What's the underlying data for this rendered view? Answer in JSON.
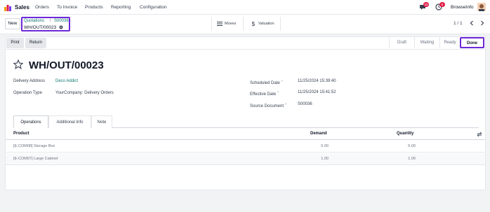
{
  "navbar": {
    "app_name": "Sales",
    "menus": [
      "Orders",
      "To Invoice",
      "Products",
      "Reporting",
      "Configuration"
    ],
    "messages_count": "15",
    "activities_count": "6",
    "user_name": "BrowseInfo"
  },
  "control": {
    "new_label": "New",
    "breadcrumb": {
      "parent": "Quotations",
      "separator": "/",
      "order": "S00036",
      "current": "WH/OUT/00023"
    },
    "smart_buttons": [
      {
        "label": "Moves"
      },
      {
        "label": "Valuation"
      }
    ],
    "pager": "1 / 1"
  },
  "header": {
    "buttons": [
      "Print",
      "Return"
    ],
    "stages": [
      "Draft",
      "Waiting",
      "Ready",
      "Done"
    ],
    "active_stage": "Done",
    "accent_color": "#6d28d9"
  },
  "form": {
    "title": "WH/OUT/00023",
    "delivery_address_label": "Delivery Address",
    "delivery_address": "Deco Addict",
    "operation_type_label": "Operation Type",
    "operation_type": "YourCompany: Delivery Orders",
    "scheduled_date_label": "Scheduled Date",
    "scheduled_date": "11/25/2024 15:39:40",
    "effective_date_label": "Effective Date",
    "effective_date": "11/25/2024 15:41:52",
    "source_document_label": "Source Document",
    "source_document": "S00036",
    "help_mark": "?"
  },
  "tabs": [
    "Operations",
    "Additional Info",
    "Note"
  ],
  "table": {
    "headers": {
      "product": "Product",
      "demand": "Demand",
      "quantity": "Quantity"
    },
    "rows": [
      {
        "product": "[E-COM08] Storage Box",
        "demand": "5.00",
        "quantity": "5.00"
      },
      {
        "product": "[E-COM07] Large Cabinet",
        "demand": "1.00",
        "quantity": "1.00"
      }
    ]
  }
}
